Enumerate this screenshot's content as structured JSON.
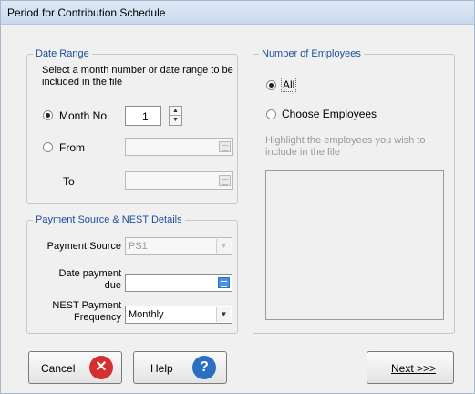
{
  "window": {
    "title": "Period for Contribution Schedule"
  },
  "date_range": {
    "title": "Date Range",
    "description": "Select a month number or date range to be included in the file",
    "month_no_label": "Month No.",
    "month_no_value": "1",
    "from_label": "From",
    "to_label": "To",
    "from_value": "",
    "to_value": ""
  },
  "payment": {
    "title": "Payment Source & NEST Details",
    "source_label": "Payment Source",
    "source_value": "PS1",
    "date_due_label_line1": "Date payment",
    "date_due_label_line2": "due",
    "date_due_value": "",
    "frequency_label_line1": "NEST Payment",
    "frequency_label_line2": "Frequency",
    "frequency_value": "Monthly"
  },
  "employees": {
    "title": "Number of Employees",
    "all_label": "All",
    "choose_label": "Choose Employees",
    "hint": "Highlight the employees you wish to include in the file",
    "selected_option": "All"
  },
  "buttons": {
    "cancel_label": "Cancel",
    "help_label": "Help",
    "next_label": "Next >>>"
  },
  "icons": {
    "cancel_icon": "close-icon",
    "help_icon": "question-icon",
    "calendar_icon": "calendar-icon",
    "dropdown_icon": "chevron-down-icon"
  },
  "colors": {
    "group_title": "#1a4f9c",
    "cancel_icon": "#d43030",
    "help_icon": "#2b6fc4"
  }
}
